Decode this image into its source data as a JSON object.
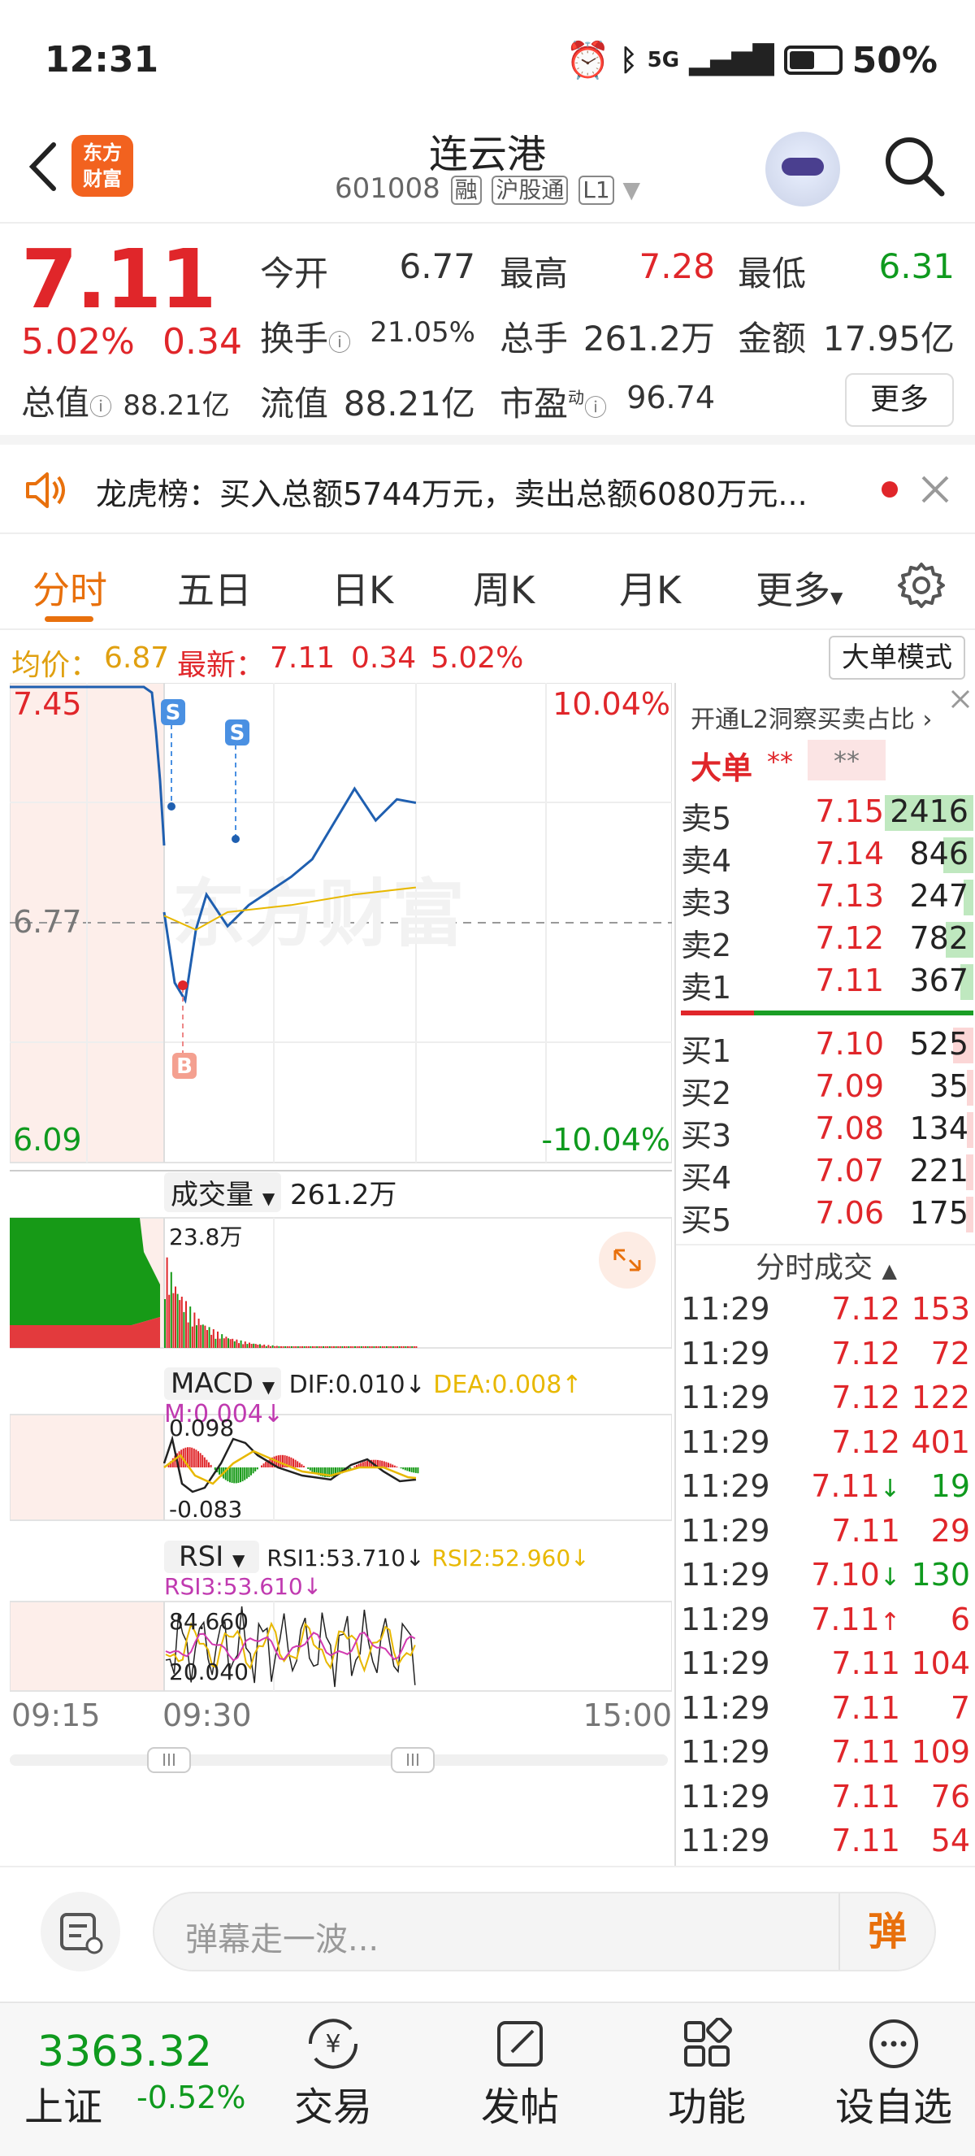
{
  "status_bar": {
    "time": "12:31",
    "network": "5G",
    "battery": "50%"
  },
  "header": {
    "stock_name": "连云港",
    "stock_code": "601008",
    "tags": [
      "融",
      "沪股通",
      "L1"
    ],
    "logo_text": [
      "东方",
      "财富"
    ]
  },
  "quote": {
    "price": "7.11",
    "change_pct": "5.02%",
    "change": "0.34",
    "rows": [
      [
        {
          "label": "今开",
          "value": "6.77",
          "color": "gray"
        },
        {
          "label": "最高",
          "value": "7.28",
          "color": "red"
        },
        {
          "label": "最低",
          "value": "6.31",
          "color": "green"
        }
      ],
      [
        {
          "label": "换手",
          "value": "21.05%",
          "color": "gray"
        },
        {
          "label": "总手",
          "value": "261.2万",
          "color": "gray"
        },
        {
          "label": "金额",
          "value": "17.95亿",
          "color": "gray"
        }
      ],
      [
        {
          "label": "流值",
          "value": "88.21亿",
          "color": "gray"
        },
        {
          "label": "市盈",
          "value": "96.74",
          "color": "gray"
        }
      ]
    ],
    "market_value_label": "总值",
    "market_value": "88.21亿",
    "pe_superscript": "动",
    "more_label": "更多"
  },
  "banner": {
    "text": "龙虎榜：买入总额5744万元，卖出总额6080万元..."
  },
  "tabs": [
    "分时",
    "五日",
    "日K",
    "周K",
    "月K",
    "更多"
  ],
  "info_line": {
    "avg_label": "均价：",
    "avg": "6.87",
    "latest_label": "最新：",
    "latest": "7.11",
    "change": "0.34",
    "change_pct": "5.02%"
  },
  "big_order_button": "大单模式",
  "chart": {
    "price_high": "7.45",
    "price_low": "6.09",
    "price_ref": "6.77",
    "pct_high": "10.04%",
    "pct_low": "-10.04%",
    "watermark": "东方财富",
    "sell_marker": "S",
    "buy_marker": "B",
    "volume_selector": "成交量",
    "volume_total": "261.2万",
    "volume_max": "23.8万",
    "macd_selector": "MACD",
    "dif": "DIF:0.010",
    "dea": "DEA:0.008",
    "m": "M:0.004",
    "macd_high": "0.098",
    "macd_low": "-0.083",
    "rsi_selector": "RSI",
    "rsi1": "RSI1:53.710",
    "rsi2": "RSI2:52.960",
    "rsi3": "RSI3:53.610",
    "rsi_high": "84.660",
    "rsi_low": "20.040",
    "time_start": "09:15",
    "time_open": "09:30",
    "time_end": "15:00"
  },
  "chart_data": {
    "type": "line",
    "title": "",
    "x_ticks": [
      "09:15",
      "09:30",
      "15:00"
    ],
    "ylim": [
      6.09,
      7.45
    ],
    "reference_price": 6.77,
    "series": [
      {
        "name": "",
        "x": [
          "09:30",
          "09:35",
          "09:40",
          "09:45",
          "09:50",
          "10:00",
          "10:10",
          "10:20",
          "10:30",
          "10:40",
          "10:50",
          "11:00",
          "11:10",
          "11:20",
          "11:29"
        ],
        "values": [
          6.8,
          6.6,
          6.55,
          6.75,
          6.85,
          6.76,
          6.82,
          6.86,
          6.9,
          6.95,
          7.05,
          7.15,
          7.06,
          7.12,
          7.11
        ]
      },
      {
        "name": "",
        "x": [
          "09:30",
          "09:45",
          "10:00",
          "10:30",
          "11:00",
          "11:29"
        ],
        "values": [
          6.79,
          6.75,
          6.8,
          6.82,
          6.85,
          6.87
        ]
      }
    ]
  },
  "orderbook": {
    "promo": "开通L2洞察买卖占比",
    "big_label": "大单",
    "big_value1": "**",
    "big_value2": "**",
    "sells": [
      {
        "name": "卖5",
        "price": "7.15",
        "qty": "2416",
        "bar": 0.35
      },
      {
        "name": "卖4",
        "price": "7.14",
        "qty": "846",
        "bar": 0.12
      },
      {
        "name": "卖3",
        "price": "7.13",
        "qty": "247",
        "bar": 0.04
      },
      {
        "name": "卖2",
        "price": "7.12",
        "qty": "782",
        "bar": 0.11
      },
      {
        "name": "卖1",
        "price": "7.11",
        "qty": "367",
        "bar": 0.05
      }
    ],
    "buys": [
      {
        "name": "买1",
        "price": "7.10",
        "qty": "525",
        "bar": 0.08
      },
      {
        "name": "买2",
        "price": "7.09",
        "qty": "35",
        "bar": 0.01
      },
      {
        "name": "买3",
        "price": "7.08",
        "qty": "134",
        "bar": 0.02
      },
      {
        "name": "买4",
        "price": "7.07",
        "qty": "221",
        "bar": 0.03
      },
      {
        "name": "买5",
        "price": "7.06",
        "qty": "175",
        "bar": 0.03
      }
    ],
    "trades_title": "分时成交",
    "trades": [
      {
        "t": "11:29",
        "p": "7.12",
        "q": "153",
        "dir": ""
      },
      {
        "t": "11:29",
        "p": "7.12",
        "q": "72",
        "dir": ""
      },
      {
        "t": "11:29",
        "p": "7.12",
        "q": "122",
        "dir": ""
      },
      {
        "t": "11:29",
        "p": "7.12",
        "q": "401",
        "dir": ""
      },
      {
        "t": "11:29",
        "p": "7.11",
        "q": "19",
        "dir": "down"
      },
      {
        "t": "11:29",
        "p": "7.11",
        "q": "29",
        "dir": ""
      },
      {
        "t": "11:29",
        "p": "7.10",
        "q": "130",
        "dir": "down"
      },
      {
        "t": "11:29",
        "p": "7.11",
        "q": "6",
        "dir": "up"
      },
      {
        "t": "11:29",
        "p": "7.11",
        "q": "104",
        "dir": ""
      },
      {
        "t": "11:29",
        "p": "7.11",
        "q": "7",
        "dir": ""
      },
      {
        "t": "11:29",
        "p": "7.11",
        "q": "109",
        "dir": ""
      },
      {
        "t": "11:29",
        "p": "7.11",
        "q": "76",
        "dir": ""
      },
      {
        "t": "11:29",
        "p": "7.11",
        "q": "54",
        "dir": ""
      }
    ]
  },
  "input": {
    "placeholder": "弹幕走一波...",
    "send": "弹"
  },
  "bottom_nav": {
    "index_value": "3363.32",
    "index_name": "上证",
    "index_change": "-0.52%",
    "items": [
      "交易",
      "发帖",
      "功能",
      "设自选"
    ]
  }
}
